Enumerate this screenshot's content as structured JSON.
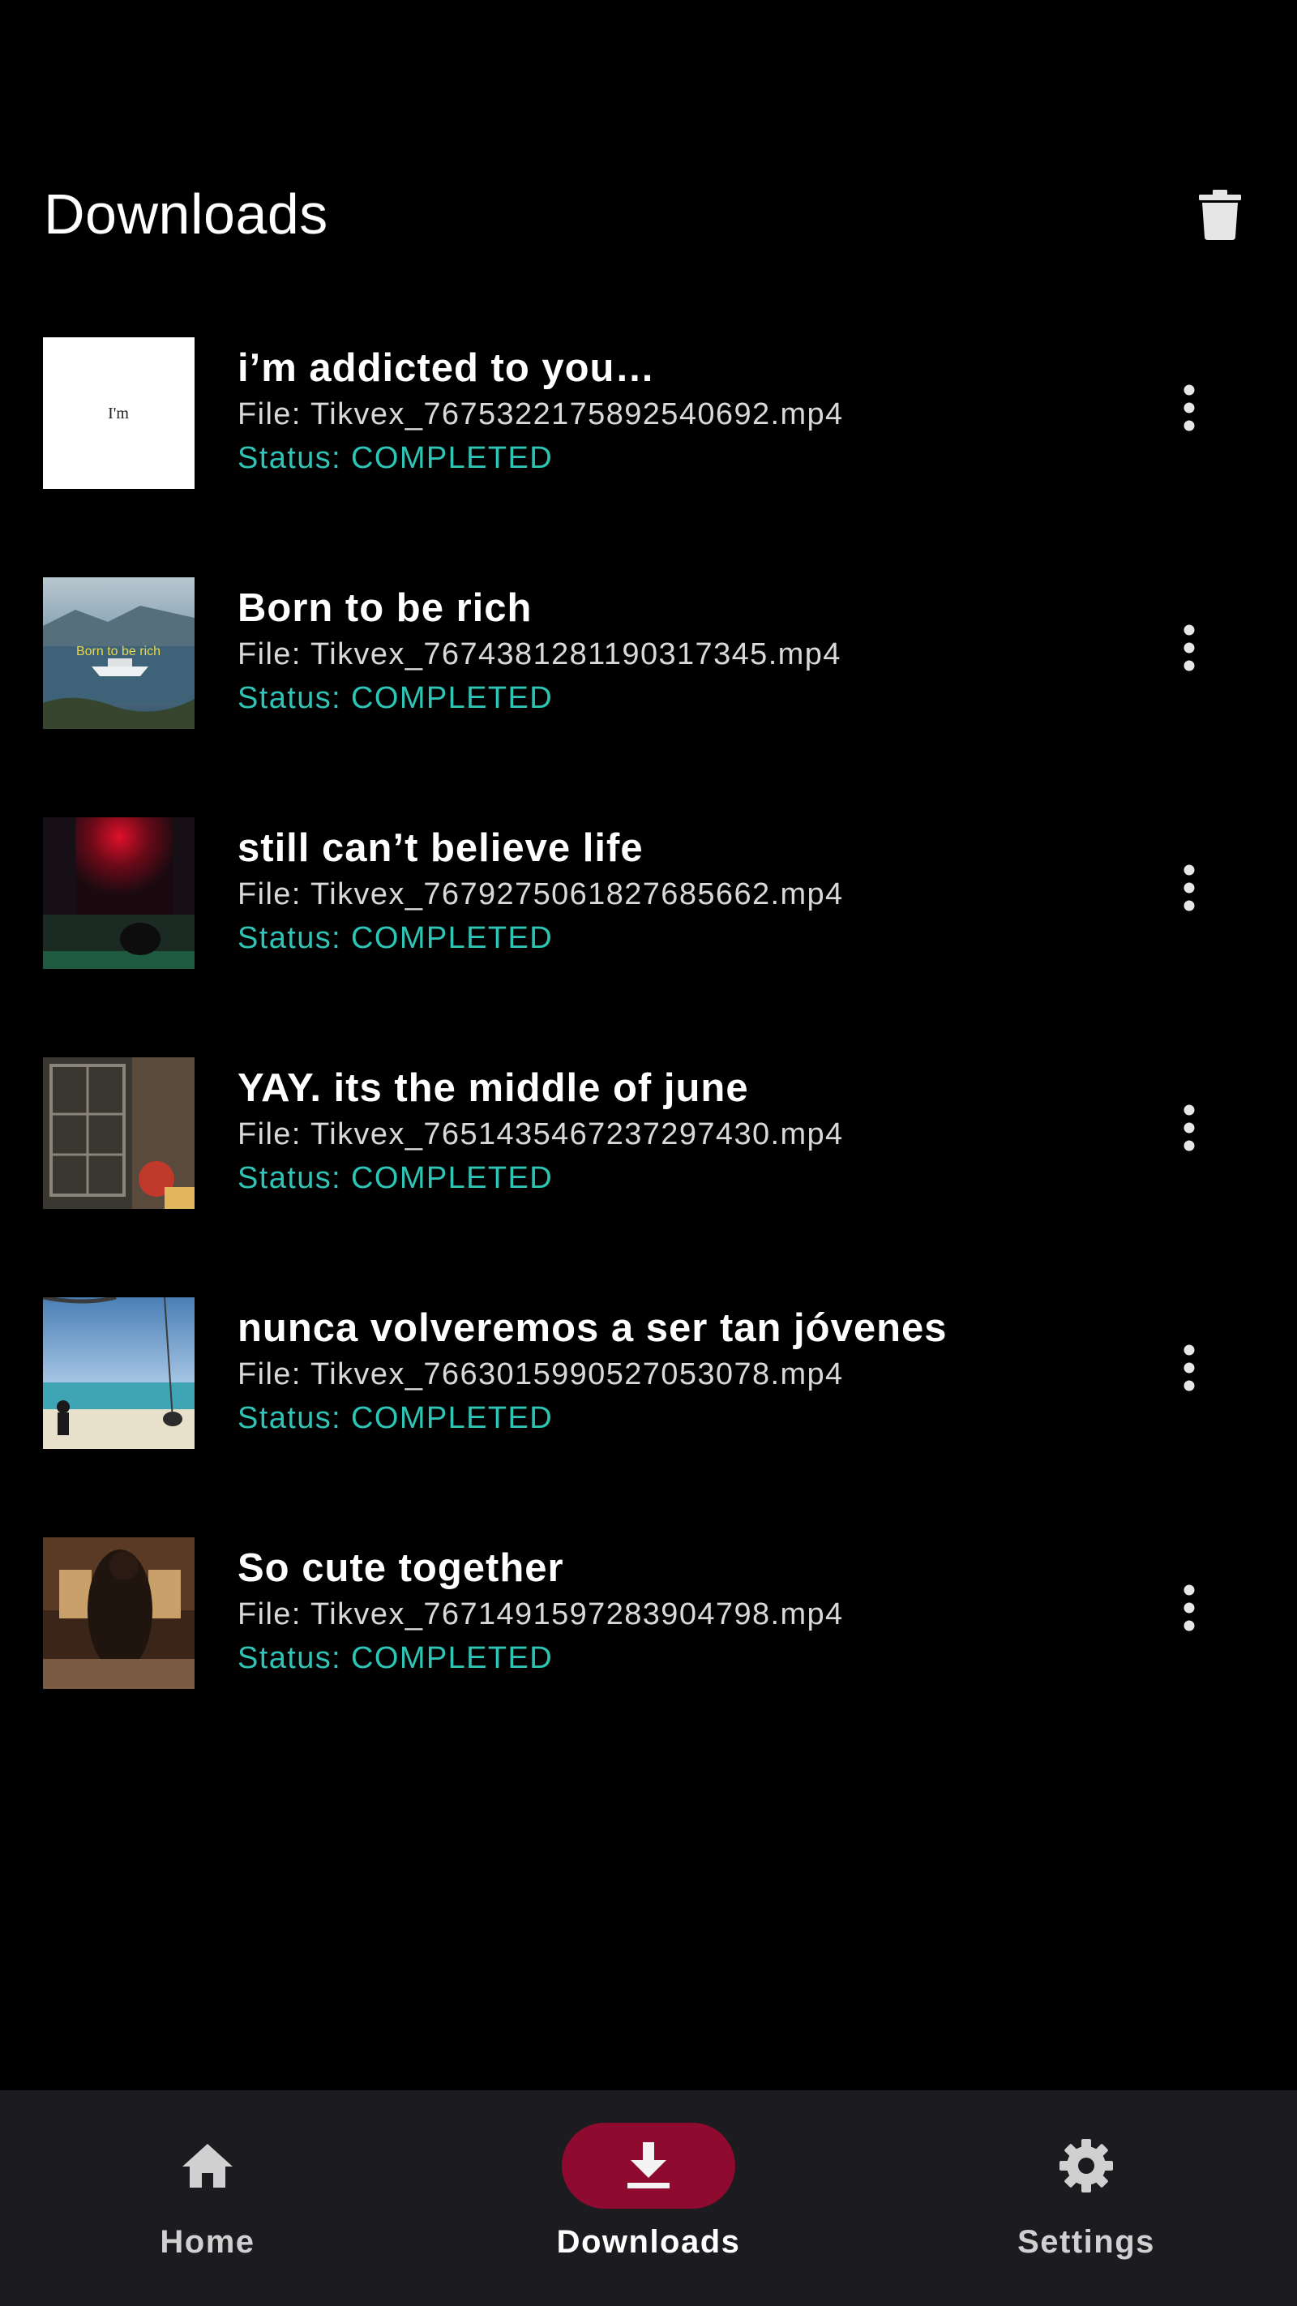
{
  "header": {
    "title": "Downloads",
    "delete_icon": "trash-icon"
  },
  "downloads": [
    {
      "title": "i’m addicted to you…",
      "file": "File: Tikvex_7675322175892540692.mp4",
      "status": "Status: COMPLETED",
      "thumbnail_text": "I'm"
    },
    {
      "title": "Born to be rich",
      "file": "File: Tikvex_7674381281190317345.mp4",
      "status": "Status: COMPLETED",
      "thumbnail_text": "Born to be rich"
    },
    {
      "title": "still can’t believe life",
      "file": "File: Tikvex_7679275061827685662.mp4",
      "status": "Status: COMPLETED"
    },
    {
      "title": "YAY. its the middle of june",
      "file": "File: Tikvex_7651435467237297430.mp4",
      "status": "Status: COMPLETED"
    },
    {
      "title": "nunca volveremos a ser tan jóvenes",
      "file": "File: Tikvex_7663015990527053078.mp4",
      "status": "Status: COMPLETED"
    },
    {
      "title": "So cute together",
      "file": "File: Tikvex_7671491597283904798.mp4",
      "status": "Status: COMPLETED"
    }
  ],
  "bottom_nav": {
    "items": [
      {
        "label": "Home",
        "icon": "home-icon",
        "selected": false
      },
      {
        "label": "Downloads",
        "icon": "download-icon",
        "selected": true
      },
      {
        "label": "Settings",
        "icon": "gear-icon",
        "selected": false
      }
    ]
  },
  "colors": {
    "background": "#000000",
    "status": "#2ec4b6",
    "nav_background": "#1c1c20",
    "nav_selected_pill": "#8e0a2e",
    "nav_text": "#d0d0d0"
  }
}
